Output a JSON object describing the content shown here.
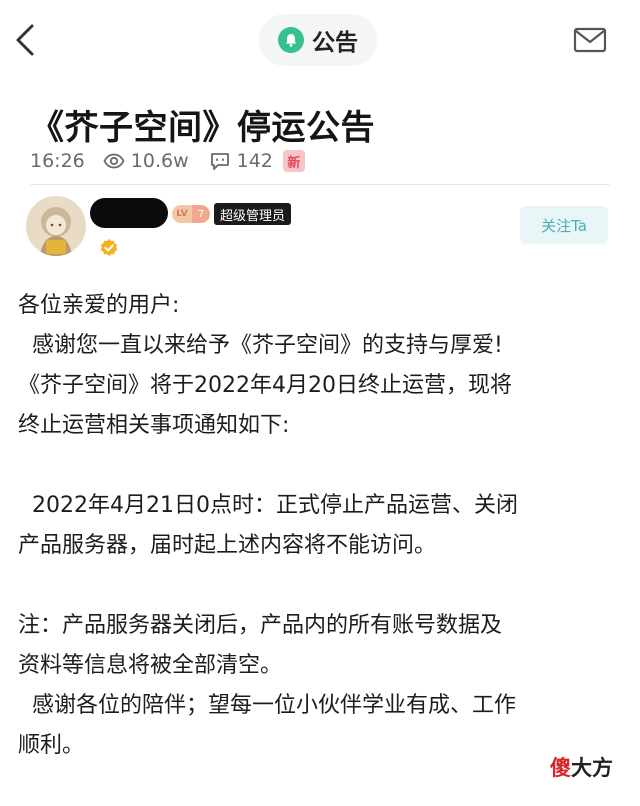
{
  "nav": {
    "title": "公告",
    "back_icon": "chevron-left-icon",
    "bell_icon": "bell-icon",
    "mail_icon": "mail-icon",
    "accent": "#35c08e"
  },
  "post": {
    "title": "《芥子空间》停运公告",
    "time": "16:26",
    "views": "10.6w",
    "comments": "142",
    "new_badge": "新"
  },
  "author": {
    "level_prefix": "LV",
    "level": "7",
    "role": "超级管理员",
    "follow_label": "关注Ta"
  },
  "body": {
    "lines": [
      "各位亲爱的用户:",
      "  感谢您一直以来给予《芥子空间》的支持与厚爱!",
      "《芥子空间》将于2022年4月20日终止运营，现将",
      "终止运营相关事项通知如下:",
      "",
      "  2022年4月21日0点时：正式停止产品运营、关闭",
      "产品服务器，届时起上述内容将不能访问。",
      "",
      "注：产品服务器关闭后，产品内的所有账号数据及",
      "资料等信息将被全部清空。",
      "  感谢各位的陪伴；望每一位小伙伴学业有成、工作",
      "顺利。"
    ]
  },
  "watermark": {
    "part1": "傻",
    "part2": "大方"
  }
}
